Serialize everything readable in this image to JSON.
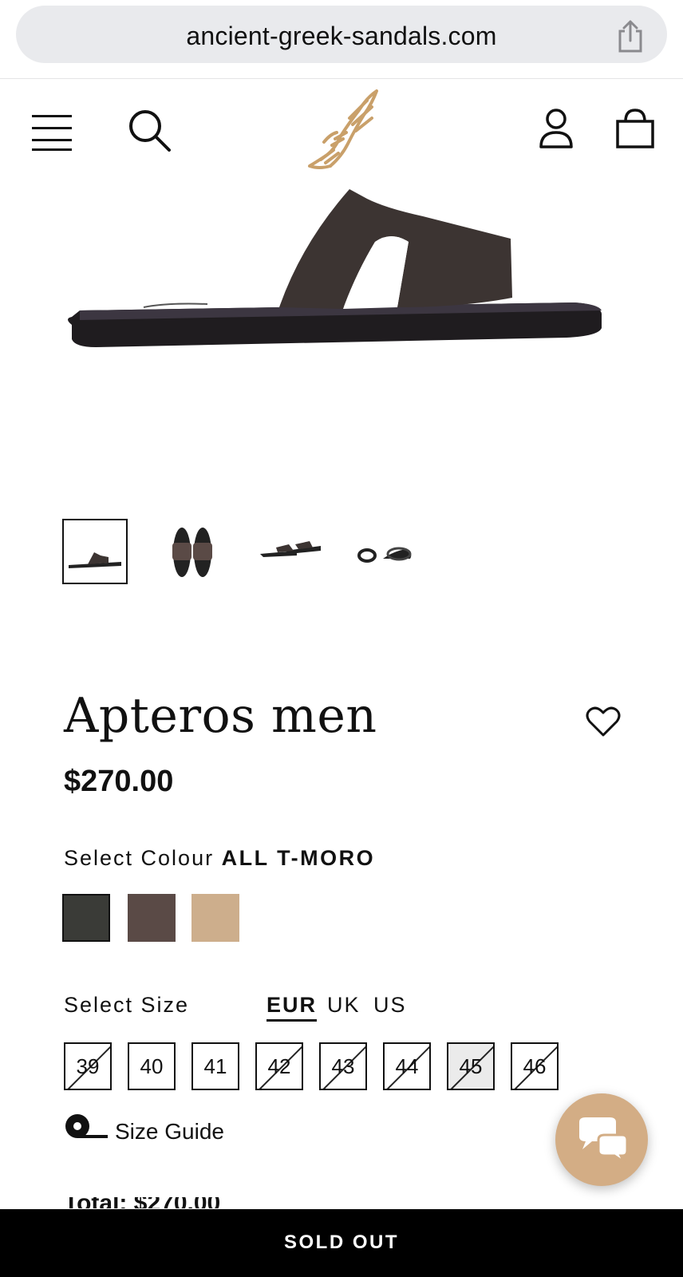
{
  "browser": {
    "url": "ancient-greek-sandals.com",
    "share_icon": "share-icon"
  },
  "header": {
    "menu_icon": "hamburger-menu-icon",
    "search_icon": "search-icon",
    "logo_icon": "winged-sandal-logo",
    "account_icon": "account-icon",
    "bag_icon": "shopping-bag-icon"
  },
  "gallery": {
    "thumbnails": [
      {
        "view": "side",
        "active": true
      },
      {
        "view": "top-pair",
        "active": false
      },
      {
        "view": "angled-pair",
        "active": false
      },
      {
        "view": "front-back",
        "active": false
      }
    ]
  },
  "product": {
    "title": "Apteros men",
    "price": "$270.00",
    "favourite_icon": "heart-icon"
  },
  "colour": {
    "label": "Select Colour",
    "selected": "ALL T-MORO",
    "swatches": [
      {
        "color": "#3a3b37",
        "selected": true
      },
      {
        "color": "#5a4a46",
        "selected": false
      },
      {
        "color": "#cdae8c",
        "selected": false
      }
    ]
  },
  "size": {
    "label": "Select Size",
    "units": [
      {
        "label": "EUR",
        "active": true
      },
      {
        "label": "UK",
        "active": false
      },
      {
        "label": "US",
        "active": false
      }
    ],
    "options": [
      {
        "label": "39",
        "available": false,
        "highlighted": false
      },
      {
        "label": "40",
        "available": true,
        "highlighted": false
      },
      {
        "label": "41",
        "available": true,
        "highlighted": false
      },
      {
        "label": "42",
        "available": false,
        "highlighted": false
      },
      {
        "label": "43",
        "available": false,
        "highlighted": false
      },
      {
        "label": "44",
        "available": false,
        "highlighted": false
      },
      {
        "label": "45",
        "available": false,
        "highlighted": true
      },
      {
        "label": "46",
        "available": false,
        "highlighted": false
      }
    ],
    "guide_label": "Size Guide",
    "guide_icon": "measuring-tape-icon"
  },
  "chat": {
    "icon": "chat-bubbles-icon",
    "color": "#d3ad85"
  },
  "footer": {
    "total_partial": "Total: $270.00",
    "button_label": "SOLD OUT"
  }
}
